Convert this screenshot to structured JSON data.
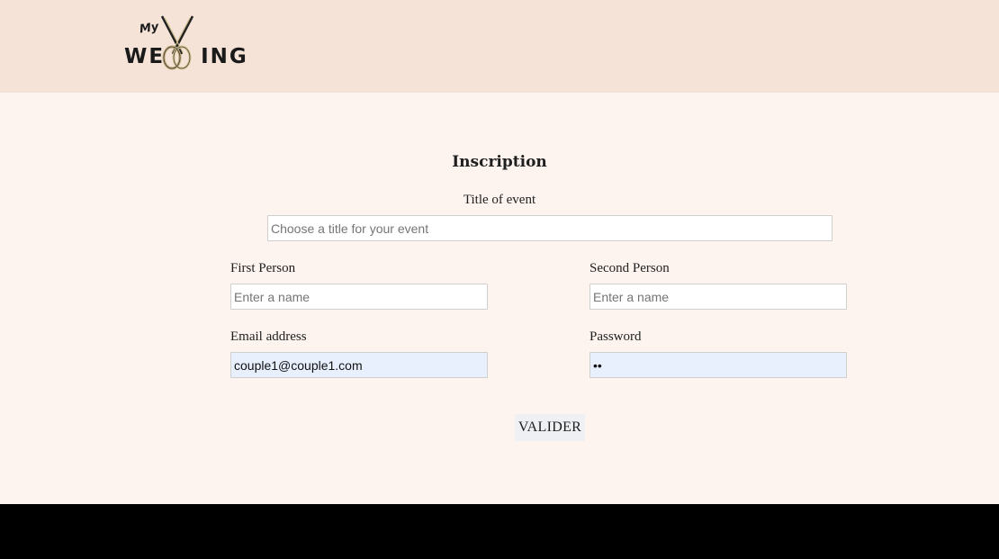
{
  "header": {
    "logo": {
      "small_text": "My",
      "word_left": "WE",
      "word_right": "ING"
    }
  },
  "form": {
    "title": "Inscription",
    "event_title": {
      "label": "Title of event",
      "placeholder": "Choose a title for your event",
      "value": ""
    },
    "first_person": {
      "label": "First Person",
      "placeholder": "Enter a name",
      "value": ""
    },
    "second_person": {
      "label": "Second Person",
      "placeholder": "Enter a name",
      "value": ""
    },
    "email": {
      "label": "Email address",
      "value": "couple1@couple1.com"
    },
    "password": {
      "label": "Password",
      "value": "ab"
    },
    "submit_label": "VALIDER"
  },
  "colors": {
    "header_bg": "#f5e3d7",
    "page_bg": "#fdf4ef",
    "footer_bg": "#000000",
    "autofill_bg": "#e8f0fe",
    "button_bg": "#eef0f3"
  }
}
